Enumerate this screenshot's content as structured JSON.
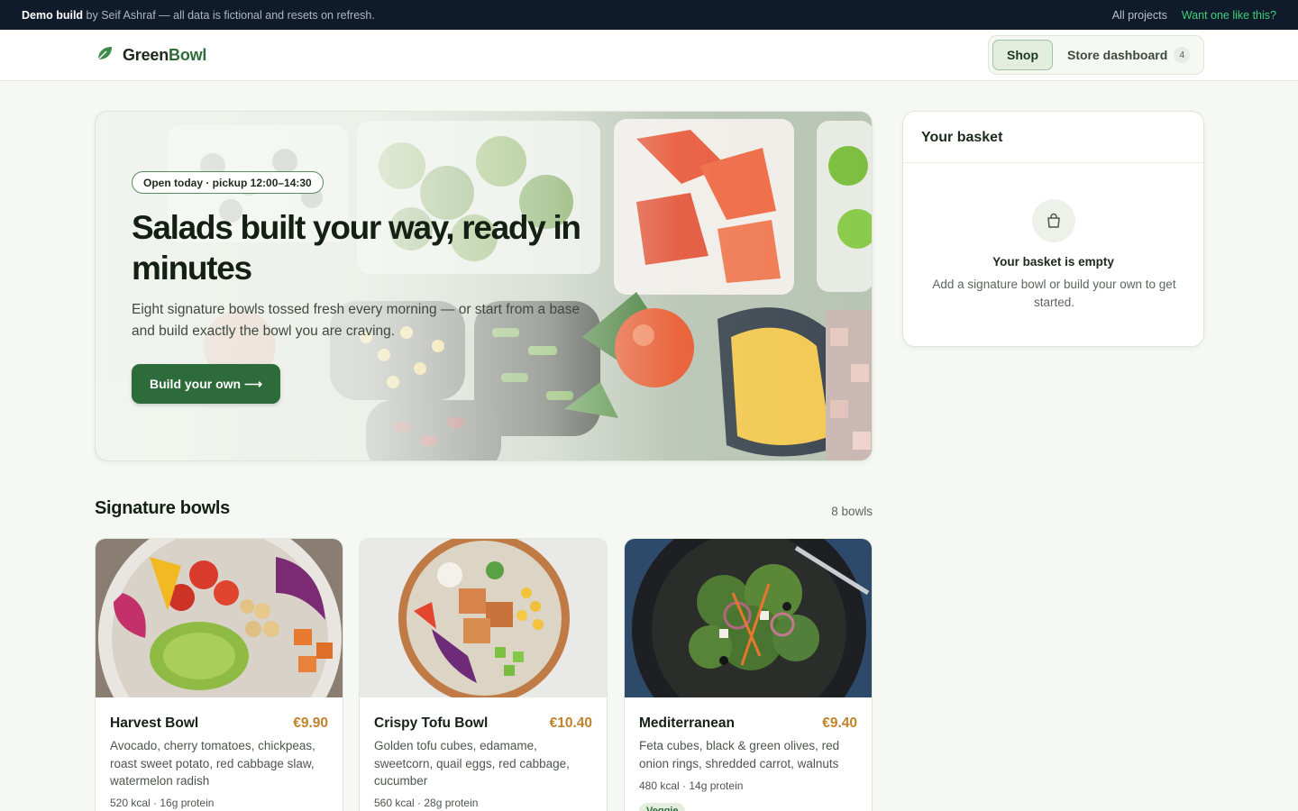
{
  "demo_bar": {
    "brand": "Demo build",
    "note": "by Seif Ashraf — all data is fictional and resets on refresh.",
    "all_projects": "All projects",
    "cta": "Want one like this?"
  },
  "header": {
    "logo_part1": "Green",
    "logo_part2": "Bowl",
    "nav_shop": "Shop",
    "nav_dashboard": "Store dashboard",
    "dashboard_count": "4"
  },
  "hero": {
    "badge": "Open today · pickup 12:00–14:30",
    "title": "Salads built your way, ready in minutes",
    "subtitle": "Eight signature bowls tossed fresh every morning — or start from a base and build exactly the bowl you are craving.",
    "button": "Build your own ⟶"
  },
  "basket": {
    "title": "Your basket",
    "empty_title": "Your basket is empty",
    "empty_hint": "Add a signature bowl or build your own to get started."
  },
  "signature": {
    "title": "Signature bowls",
    "count": "8 bowls",
    "cards": [
      {
        "name": "Harvest Bowl",
        "price": "€9.90",
        "description": "Avocado, cherry tomatoes, chickpeas, roast sweet potato, red cabbage slaw, watermelon radish",
        "meta": "520 kcal · 16g protein"
      },
      {
        "name": "Crispy Tofu Bowl",
        "price": "€10.40",
        "description": "Golden tofu cubes, edamame, sweetcorn, quail eggs, red cabbage, cucumber",
        "meta": "560 kcal · 28g protein"
      },
      {
        "name": "Mediterranean",
        "price": "€9.40",
        "description": "Feta cubes, black & green olives, red onion rings, shredded carrot, walnuts",
        "meta": "480 kcal · 14g protein",
        "tag": "Veggie"
      }
    ]
  },
  "icons": {
    "logo": "leaf-icon",
    "basket": "shopping-bag-icon"
  },
  "colors": {
    "brand_green": "#2e6b3a",
    "price": "#c0822a",
    "background": "#f6f8f3",
    "demo_bar": "#0f1a2b",
    "cta": "#3fd17a"
  }
}
